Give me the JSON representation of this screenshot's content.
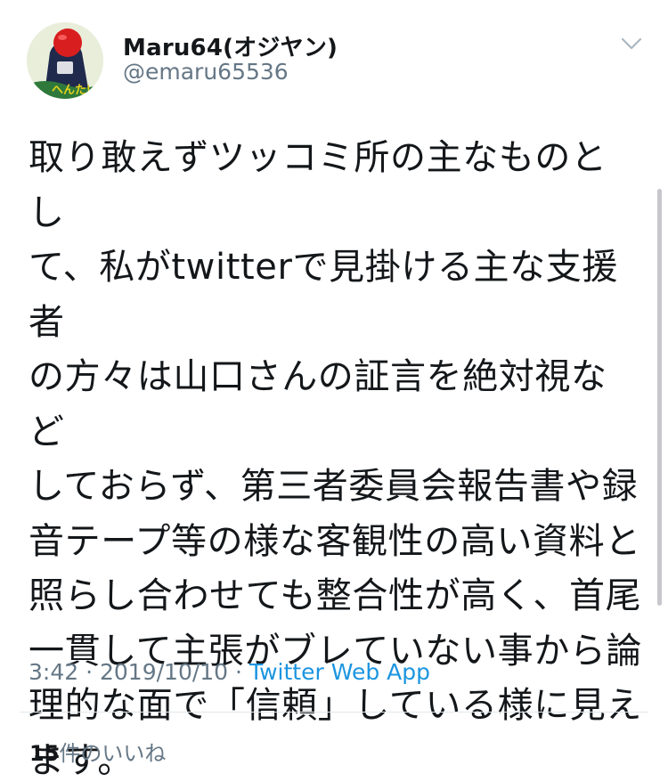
{
  "tweet": {
    "author": {
      "display_name": "Maru64(オジヤン)",
      "handle": "@emaru65536",
      "avatar_text": "へんたい"
    },
    "text": "取り敢えずツッコミ所の主なものとし\nて、私がtwitterで見掛ける主な支援者\nの方々は山口さんの証言を絶対視など\nしておらず、第三者委員会報告書や録\n音テープ等の様な客観性の高い資料と\n照らし合わせても整合性が高く、首尾\n一貫して主張がブレていない事から論\n理的な面で「信頼」している様に見え\nます。",
    "time": "3:42",
    "date": "2019/10/10",
    "separator": "·",
    "source_app": "Twitter Web App",
    "likes_count": "15",
    "likes_label": "件のいいね"
  },
  "icons": {
    "caret": "chevron-down-icon"
  },
  "colors": {
    "text": "#14171a",
    "secondary": "#657786",
    "link": "#1b95e0",
    "divider": "#e1e8ed"
  }
}
